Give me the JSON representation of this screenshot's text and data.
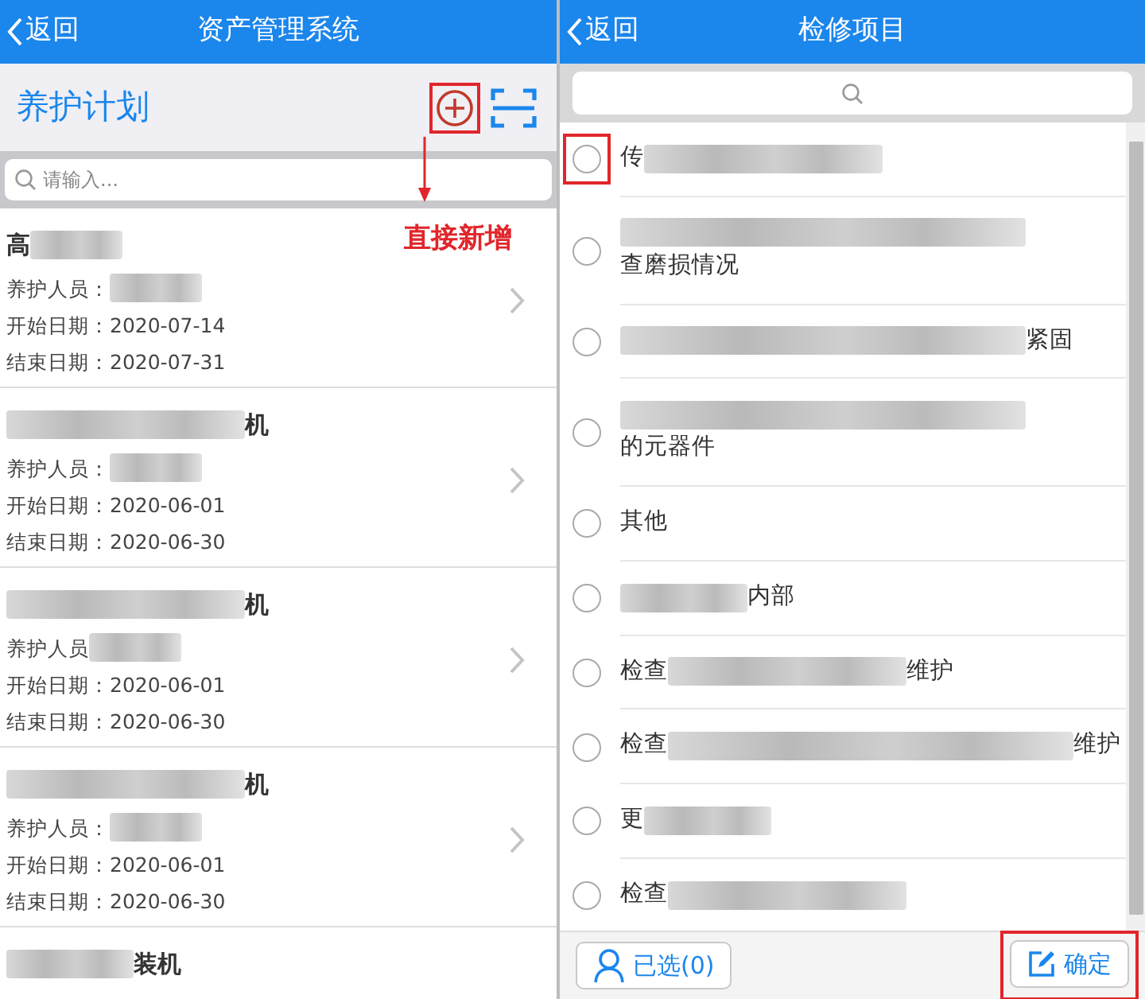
{
  "left_screen": {
    "header": {
      "back": "返回",
      "title": "资产管理系统"
    },
    "subheader": {
      "title": "养护计划",
      "add_annotated": true
    },
    "annotation": {
      "text": "直接新增"
    },
    "search": {
      "placeholder": "请输入..."
    },
    "plans": [
      {
        "title": [
          {
            "kind": "text",
            "text": "高"
          },
          {
            "kind": "blur_s"
          }
        ],
        "fields": [
          {
            "label": "养护人员：",
            "value": [
              {
                "kind": "blur_s"
              }
            ]
          },
          {
            "label": "开始日期：",
            "value": [
              {
                "kind": "text",
                "text": "2020-07-14"
              }
            ]
          },
          {
            "label": "结束日期：",
            "value": [
              {
                "kind": "text",
                "text": "2020-07-31"
              }
            ]
          }
        ]
      },
      {
        "title": [
          {
            "kind": "blur_l"
          },
          {
            "kind": "text",
            "text": "机"
          }
        ],
        "fields": [
          {
            "label": "养护人员：",
            "value": [
              {
                "kind": "blur_s"
              }
            ]
          },
          {
            "label": "开始日期：",
            "value": [
              {
                "kind": "text",
                "text": "2020-06-01"
              }
            ]
          },
          {
            "label": "结束日期：",
            "value": [
              {
                "kind": "text",
                "text": "2020-06-30"
              }
            ]
          }
        ]
      },
      {
        "title": [
          {
            "kind": "blur_l"
          },
          {
            "kind": "text",
            "text": "机"
          }
        ],
        "fields": [
          {
            "label": "养护人员",
            "value": [
              {
                "kind": "blur_s"
              }
            ]
          },
          {
            "label": "开始日期：",
            "value": [
              {
                "kind": "text",
                "text": "2020-06-01"
              }
            ]
          },
          {
            "label": "结束日期：",
            "value": [
              {
                "kind": "text",
                "text": "2020-06-30"
              }
            ]
          }
        ]
      },
      {
        "title": [
          {
            "kind": "blur_l"
          },
          {
            "kind": "text",
            "text": "机"
          }
        ],
        "fields": [
          {
            "label": "养护人员：",
            "value": [
              {
                "kind": "blur_s"
              }
            ]
          },
          {
            "label": "开始日期：",
            "value": [
              {
                "kind": "text",
                "text": "2020-06-01"
              }
            ]
          },
          {
            "label": "结束日期：",
            "value": [
              {
                "kind": "text",
                "text": "2020-06-30"
              }
            ]
          }
        ]
      },
      {
        "title": [
          {
            "kind": "blur_m"
          },
          {
            "kind": "text",
            "text": "装机"
          }
        ]
      }
    ]
  },
  "right_screen": {
    "header": {
      "back": "返回",
      "title": "检修项目"
    },
    "items": [
      {
        "selected": false,
        "annotated": true,
        "lines": [
          [
            {
              "kind": "text",
              "text": "传"
            },
            {
              "kind": "blur_l"
            }
          ]
        ]
      },
      {
        "selected": false,
        "annotated": false,
        "lines": [
          [
            {
              "kind": "blur_xl"
            }
          ],
          [
            {
              "kind": "text",
              "text": "查磨损情况"
            }
          ]
        ]
      },
      {
        "selected": false,
        "annotated": false,
        "lines": [
          [
            {
              "kind": "blur_xl"
            },
            {
              "kind": "text",
              "text": "紧固"
            }
          ]
        ]
      },
      {
        "selected": false,
        "annotated": false,
        "lines": [
          [
            {
              "kind": "blur_xl"
            }
          ],
          [
            {
              "kind": "text",
              "text": "的元器件"
            }
          ]
        ]
      },
      {
        "selected": false,
        "annotated": false,
        "lines": [
          [
            {
              "kind": "text",
              "text": "其他"
            }
          ]
        ]
      },
      {
        "selected": false,
        "annotated": false,
        "lines": [
          [
            {
              "kind": "blur_m"
            },
            {
              "kind": "text",
              "text": "内部"
            }
          ]
        ]
      },
      {
        "selected": false,
        "annotated": false,
        "lines": [
          [
            {
              "kind": "text",
              "text": "检查"
            },
            {
              "kind": "blur_l"
            },
            {
              "kind": "text",
              "text": "维护"
            }
          ]
        ]
      },
      {
        "selected": false,
        "annotated": false,
        "lines": [
          [
            {
              "kind": "text",
              "text": "检查"
            },
            {
              "kind": "blur_xl"
            },
            {
              "kind": "text",
              "text": "维护"
            }
          ]
        ]
      },
      {
        "selected": false,
        "annotated": false,
        "lines": [
          [
            {
              "kind": "text",
              "text": "更"
            },
            {
              "kind": "blur_m"
            }
          ]
        ]
      },
      {
        "selected": false,
        "annotated": false,
        "lines": [
          [
            {
              "kind": "text",
              "text": "检查"
            },
            {
              "kind": "blur_l"
            }
          ]
        ]
      }
    ],
    "footer": {
      "selected_button": "已选(0)",
      "confirm_button": "确定",
      "confirm_annotated": true
    }
  }
}
